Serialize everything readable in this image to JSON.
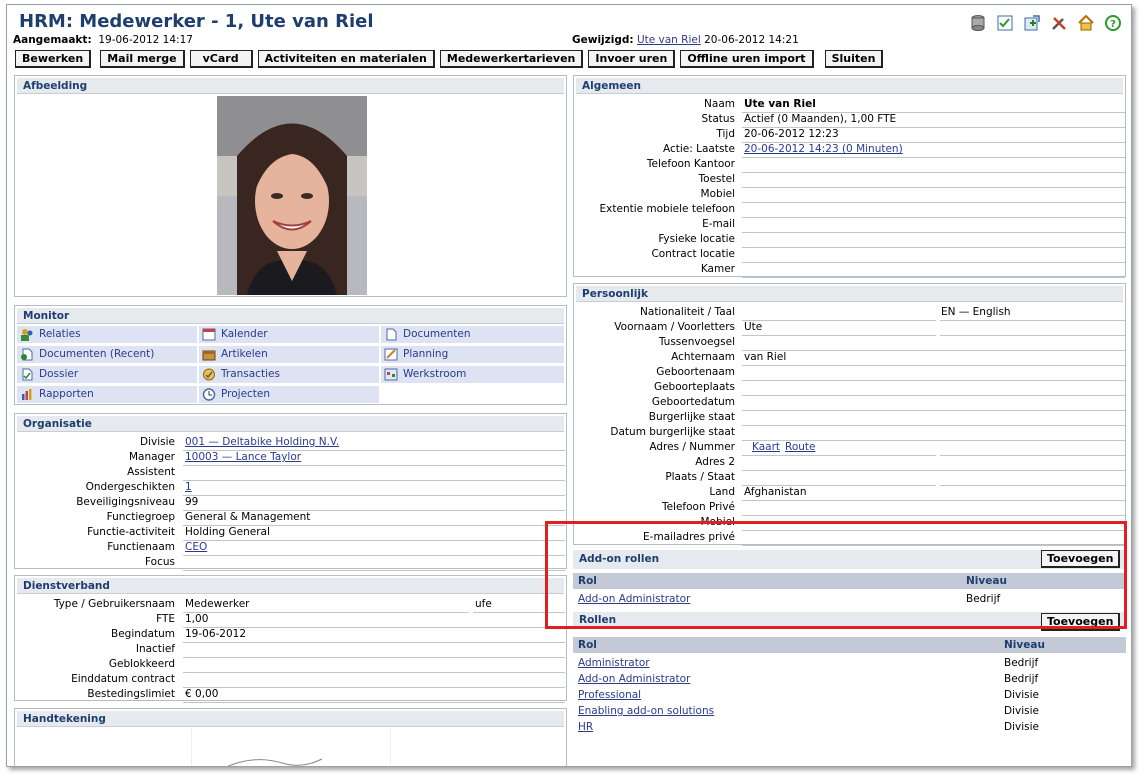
{
  "title": "HRM: Medewerker - 1, Ute van Riel",
  "meta": {
    "created_label": "Aangemaakt:",
    "created_value": "19-06-2012 14:17",
    "modified_label": "Gewijzigd:",
    "modified_by": "Ute van Riel",
    "modified_value": "20-06-2012 14:21"
  },
  "toolbar": [
    "Bewerken",
    "Mail merge",
    "vCard",
    "Activiteiten en materialen",
    "Medewerkertarieven",
    "Invoer uren",
    "Offline uren import",
    "Sluiten"
  ],
  "image_panel": {
    "title": "Afbeelding"
  },
  "monitor": {
    "title": "Monitor",
    "items": [
      "Relaties",
      "Kalender",
      "Documenten",
      "Documenten (Recent)",
      "Artikelen",
      "Planning",
      "Dossier",
      "Transacties",
      "Werkstroom",
      "Rapporten",
      "Projecten"
    ]
  },
  "organisatie": {
    "title": "Organisatie",
    "rows": [
      {
        "label": "Divisie",
        "value": "001 — Deltabike Holding N.V.",
        "link": true
      },
      {
        "label": "Manager",
        "value": "10003 — Lance Taylor",
        "link": true
      },
      {
        "label": "Assistent",
        "value": "",
        "link": false
      },
      {
        "label": "Ondergeschikten",
        "value": "1",
        "link": true
      },
      {
        "label": "Beveiligingsniveau",
        "value": "99",
        "link": false
      },
      {
        "label": "Functiegroep",
        "value": "General & Management",
        "link": false
      },
      {
        "label": "Functie-activiteit",
        "value": "Holding General",
        "link": false
      },
      {
        "label": "Functienaam",
        "value": "CEO",
        "link": true
      },
      {
        "label": "Focus",
        "value": "",
        "link": false
      }
    ]
  },
  "dienstverband": {
    "title": "Dienstverband",
    "rows": [
      {
        "label": "Type / Gebruikersnaam",
        "value": "Medewerker",
        "value2": "ufe"
      },
      {
        "label": "FTE",
        "value": "1,00",
        "value2": ""
      },
      {
        "label": "Begindatum",
        "value": "19-06-2012",
        "value2": ""
      },
      {
        "label": "Inactief",
        "value": "",
        "value2": ""
      },
      {
        "label": "Geblokkeerd",
        "value": "",
        "value2": ""
      },
      {
        "label": "Einddatum contract",
        "value": "",
        "value2": ""
      },
      {
        "label": "Bestedingslimiet",
        "value": "€ 0,00",
        "value2": ""
      }
    ]
  },
  "handtekening": {
    "title": "Handtekening"
  },
  "algemeen": {
    "title": "Algemeen",
    "rows": [
      {
        "label": "Naam",
        "value": "Ute van Riel",
        "bold": true,
        "link": false
      },
      {
        "label": "Status",
        "value": "Actief (0 Maanden), 1,00 FTE",
        "bold": false,
        "link": false
      },
      {
        "label": "Tijd",
        "value": "20-06-2012 12:23",
        "bold": false,
        "link": false
      },
      {
        "label": "Actie: Laatste",
        "value": "20-06-2012 14:23 (0 Minuten)",
        "bold": false,
        "link": true
      },
      {
        "label": "Telefoon Kantoor",
        "value": "",
        "bold": false,
        "link": false
      },
      {
        "label": "Toestel",
        "value": "",
        "bold": false,
        "link": false
      },
      {
        "label": "Mobiel",
        "value": "",
        "bold": false,
        "link": false
      },
      {
        "label": "Extentie mobiele telefoon",
        "value": "",
        "bold": false,
        "link": false
      },
      {
        "label": "E-mail",
        "value": "",
        "bold": false,
        "link": false
      },
      {
        "label": "Fysieke locatie",
        "value": "",
        "bold": false,
        "link": false
      },
      {
        "label": "Contract locatie",
        "value": "",
        "bold": false,
        "link": false
      },
      {
        "label": "Kamer",
        "value": "",
        "bold": false,
        "link": false
      }
    ]
  },
  "persoonlijk": {
    "title": "Persoonlijk",
    "rows": [
      {
        "label": "Nationaliteit / Taal",
        "value": "",
        "value2": "EN — English"
      },
      {
        "label": "Voornaam / Voorletters",
        "value": "Ute",
        "value2": ""
      },
      {
        "label": "Tussenvoegsel",
        "value": "",
        "value2": ""
      },
      {
        "label": "Achternaam",
        "value": "van Riel",
        "value2": ""
      },
      {
        "label": "Geboortenaam",
        "value": "",
        "value2": ""
      },
      {
        "label": "Geboorteplaats",
        "value": "",
        "value2": ""
      },
      {
        "label": "Geboortedatum",
        "value": "",
        "value2": ""
      },
      {
        "label": "Burgerlijke staat",
        "value": "",
        "value2": ""
      },
      {
        "label": "Datum burgerlijke staat",
        "value": "",
        "value2": ""
      },
      {
        "label": "Adres / Nummer",
        "value": "",
        "value2": ""
      },
      {
        "label": "Adres 2",
        "value": "",
        "value2": ""
      },
      {
        "label": "Plaats / Staat",
        "value": "",
        "value2": ""
      },
      {
        "label": "Land",
        "value": "Afghanistan",
        "value2": ""
      },
      {
        "label": "Telefoon Privé",
        "value": "",
        "value2": ""
      },
      {
        "label": "Mobiel",
        "value": "",
        "value2": ""
      },
      {
        "label": "E-mailadres privé",
        "value": "",
        "value2": ""
      }
    ],
    "map_link": "Kaart",
    "route_link": "Route"
  },
  "addon_rollen": {
    "title": "Add-on rollen",
    "add_button": "Toevoegen",
    "col_rol": "Rol",
    "col_niveau": "Niveau",
    "rows": [
      {
        "rol": "Add-on Administrator",
        "niveau": "Bedrijf"
      }
    ]
  },
  "rollen": {
    "title": "Rollen",
    "add_button": "Toevoegen",
    "col_rol": "Rol",
    "col_niveau": "Niveau",
    "rows": [
      {
        "rol": "Administrator",
        "niveau": "Bedrijf"
      },
      {
        "rol": "Add-on Administrator",
        "niveau": "Bedrijf"
      },
      {
        "rol": "Professional",
        "niveau": "Divisie"
      },
      {
        "rol": "Enabling add-on solutions",
        "niveau": "Divisie"
      },
      {
        "rol": "HR",
        "niveau": "Divisie"
      }
    ]
  },
  "icons": [
    "database-icon",
    "checklist-icon",
    "new-window-icon",
    "tools-icon",
    "home-icon",
    "help-icon"
  ],
  "colors": {
    "title": "#1d3e6e",
    "link": "#2b3a8c",
    "highlight": "#e02020",
    "section_bg": "#e6e9ee"
  }
}
